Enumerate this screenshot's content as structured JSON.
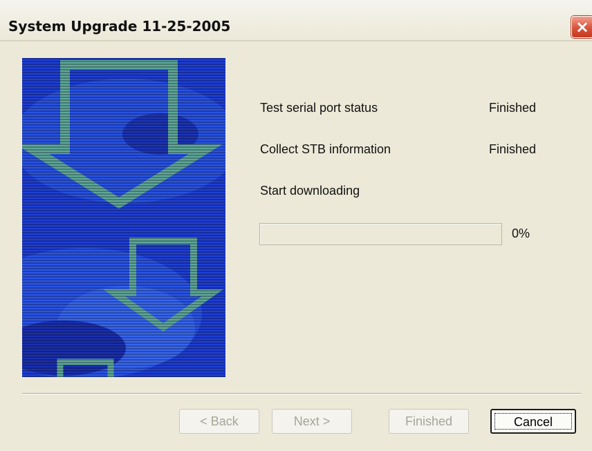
{
  "window": {
    "title": "System Upgrade 11-25-2005",
    "close_label": "×"
  },
  "steps": [
    {
      "label": "Test serial port status",
      "status": "Finished"
    },
    {
      "label": "Collect STB information",
      "status": "Finished"
    },
    {
      "label": "Start downloading",
      "status": ""
    }
  ],
  "progress": {
    "value": 0,
    "label": "0%"
  },
  "buttons": {
    "back": "< Back",
    "next": "Next >",
    "finished": "Finished",
    "cancel": "Cancel"
  },
  "colors": {
    "image_background": "#1f3fd6",
    "arrow": "#5fa89a",
    "progress_fill": "#2f8f3a"
  }
}
